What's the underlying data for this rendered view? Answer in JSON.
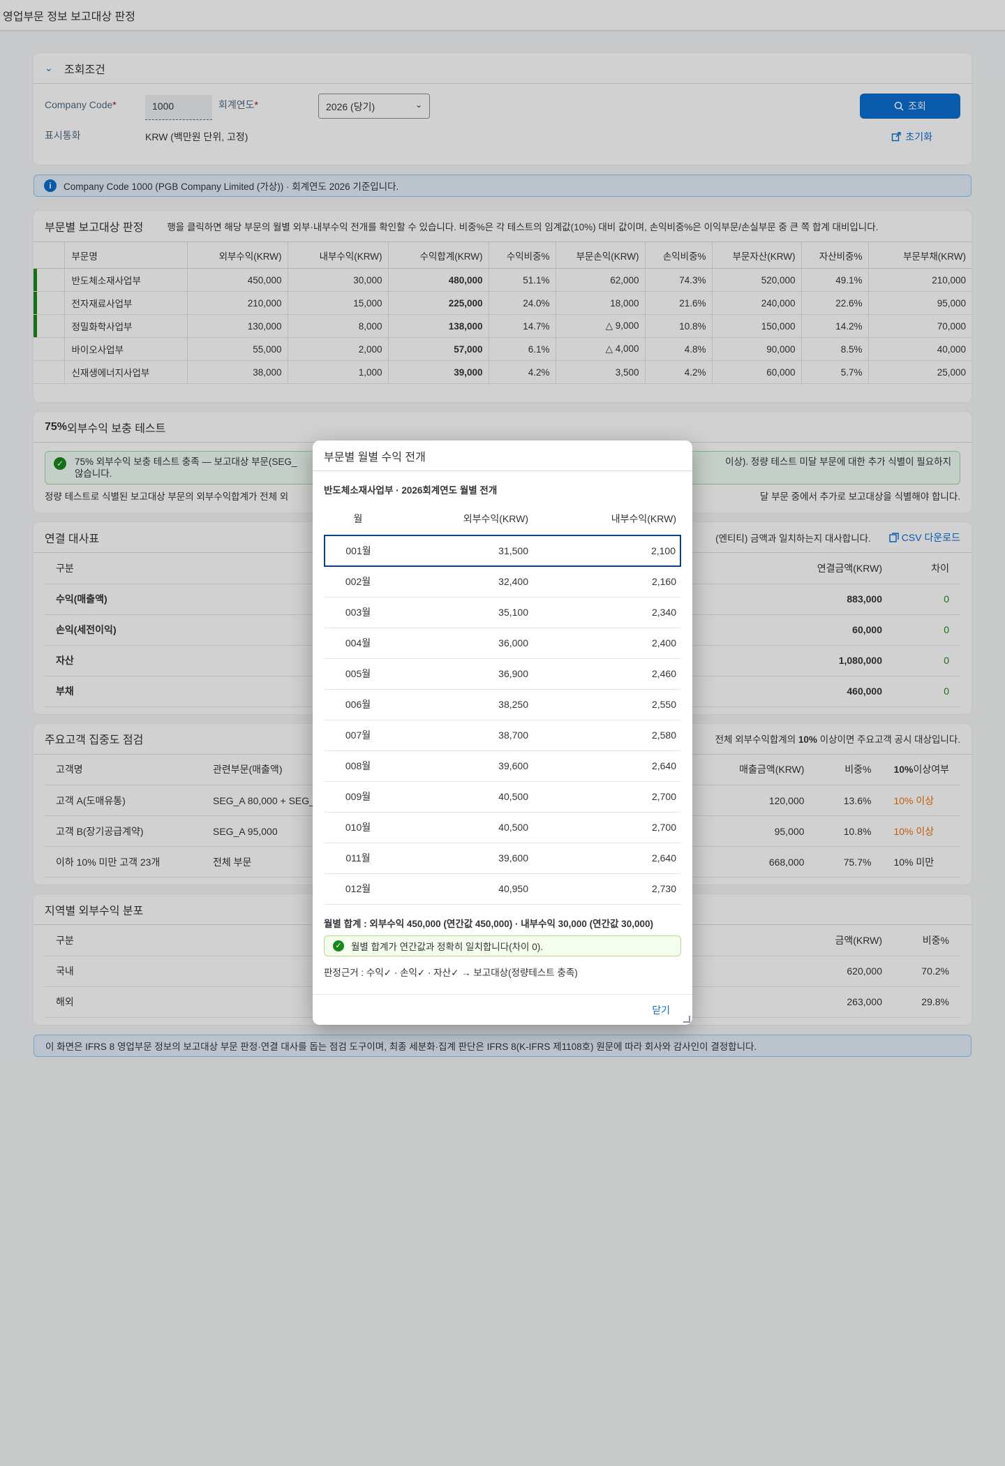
{
  "app_title": "영업부문 정보 보고대상 판정",
  "filter": {
    "title": "조회조건",
    "company_code_label": "Company Code",
    "company_code_value": "1000",
    "fiscal_year_label": "회계연도",
    "fiscal_year_value": "2026 (당기)",
    "currency_label": "표시통화",
    "currency_value": "KRW (백만원 단위, 고정)",
    "search_button": "조회",
    "reset_button": "초기화"
  },
  "info_message": "Company Code 1000 (PGB Company Limited (가상)) · 회계연도 2026 기준입니다.",
  "segment_section": {
    "title": "부문별 보고대상 판정",
    "description": "행을 클릭하면 해당 부문의 월별 외부·내부수익 전개를 확인할 수 있습니다. 비중%은 각 테스트의 임계값(10%) 대비 값이며, 손익비중%은 이익부문/손실부문 중 큰 쪽 합계 대비입니다.",
    "columns": [
      "부문명",
      "외부수익(KRW)",
      "내부수익(KRW)",
      "수익합계(KRW)",
      "수익비중%",
      "부문손익(KRW)",
      "손익비중%",
      "부문자산(KRW)",
      "자산비중%",
      "부문부채(KRW)"
    ],
    "rows": [
      {
        "reportable": true,
        "name": "반도체소재사업부",
        "ext": "450,000",
        "int": "30,000",
        "total": "480,000",
        "rev_pct": "51.1%",
        "pl": "62,000",
        "pl_pct": "74.3%",
        "asset": "520,000",
        "asset_pct": "49.1%",
        "liab": "210,000"
      },
      {
        "reportable": true,
        "name": "전자재료사업부",
        "ext": "210,000",
        "int": "15,000",
        "total": "225,000",
        "rev_pct": "24.0%",
        "pl": "18,000",
        "pl_pct": "21.6%",
        "asset": "240,000",
        "asset_pct": "22.6%",
        "liab": "95,000"
      },
      {
        "reportable": true,
        "name": "정밀화학사업부",
        "ext": "130,000",
        "int": "8,000",
        "total": "138,000",
        "rev_pct": "14.7%",
        "pl": "△ 9,000",
        "pl_pct": "10.8%",
        "asset": "150,000",
        "asset_pct": "14.2%",
        "liab": "70,000"
      },
      {
        "reportable": false,
        "name": "바이오사업부",
        "ext": "55,000",
        "int": "2,000",
        "total": "57,000",
        "rev_pct": "6.1%",
        "pl": "△ 4,000",
        "pl_pct": "4.8%",
        "asset": "90,000",
        "asset_pct": "8.5%",
        "liab": "40,000"
      },
      {
        "reportable": false,
        "name": "신재생에너지사업부",
        "ext": "38,000",
        "int": "1,000",
        "total": "39,000",
        "rev_pct": "4.2%",
        "pl": "3,500",
        "pl_pct": "4.2%",
        "asset": "60,000",
        "asset_pct": "5.7%",
        "liab": "25,000"
      }
    ]
  },
  "coverage_section": {
    "title_bold": "75%",
    "title_rest": " 외부수익 보충 테스트",
    "success_left": "75% 외부수익 보충 테스트 충족 — 보고대상 부문(SEG_",
    "success_right": "이상). 정량 테스트 미달 부문에 대한 추가 식별이 필요하지",
    "success_line2": "않습니다.",
    "note_left": "정량 테스트로 식별된 보고대상 부문의 외부수익합계가 전체 외",
    "note_right": "달 부문 중에서 추가로 보고대상을 식별해야 합니다."
  },
  "recon_section": {
    "title": "연결 대사표",
    "desc_right": "(엔티티) 금액과 일치하는지 대사합니다.",
    "csv_label": "CSV 다운로드",
    "columns": [
      "구분",
      "연결금액(KRW)",
      "차이"
    ],
    "rows": [
      {
        "label": "수익(매출액)",
        "amount": "883,000",
        "diff": "0"
      },
      {
        "label": "손익(세전이익)",
        "amount": "60,000",
        "diff": "0"
      },
      {
        "label": "자산",
        "amount": "1,080,000",
        "diff": "0"
      },
      {
        "label": "부채",
        "amount": "460,000",
        "diff": "0"
      }
    ]
  },
  "customer_section": {
    "title": "주요고객 집중도 점검",
    "desc_pre": "전체 외부수익합계의 ",
    "desc_bold": "10%",
    "desc_post": " 이상이면 주요고객 공시 대상입니다.",
    "columns": [
      "고객명",
      "관련부문(매출액)",
      "매출금액(KRW)",
      "비중%",
      "10%",
      "이상여부"
    ],
    "rows": [
      {
        "name": "고객 A(도매유통)",
        "seg": "SEG_A 80,000 + SEG_B",
        "amount": "120,000",
        "pct": "13.6%",
        "flag": "10% 이상",
        "warn": true
      },
      {
        "name": "고객 B(장기공급계약)",
        "seg": "SEG_A 95,000",
        "amount": "95,000",
        "pct": "10.8%",
        "flag": "10% 이상",
        "warn": true
      },
      {
        "name": "이하 10% 미만 고객 23개",
        "seg": "전체 부문",
        "amount": "668,000",
        "pct": "75.7%",
        "flag": "10% 미만",
        "warn": false
      }
    ]
  },
  "region_section": {
    "title": "지역별 외부수익 분포",
    "columns": [
      "구분",
      "금액(KRW)",
      "비중%"
    ],
    "rows": [
      {
        "label": "국내",
        "amount": "620,000",
        "pct": "70.2%"
      },
      {
        "label": "해외",
        "amount": "263,000",
        "pct": "29.8%"
      }
    ]
  },
  "footer_message": "이 화면은 IFRS 8 영업부문 정보의 보고대상 부문 판정·연결 대사를 돕는 점검 도구이며, 최종 세분화·집계 판단은 IFRS 8(K-IFRS 제1108호) 원문에 따라 회사와 감사인이 결정합니다.",
  "dialog": {
    "title": "부문별 월별 수익 전개",
    "subtitle": "반도체소재사업부 · 2026회계연도 월별 전개",
    "columns": [
      "월",
      "외부수익(KRW)",
      "내부수익(KRW)"
    ],
    "rows": [
      {
        "month": "001월",
        "ext": "31,500",
        "int": "2,100"
      },
      {
        "month": "002월",
        "ext": "32,400",
        "int": "2,160"
      },
      {
        "month": "003월",
        "ext": "35,100",
        "int": "2,340"
      },
      {
        "month": "004월",
        "ext": "36,000",
        "int": "2,400"
      },
      {
        "month": "005월",
        "ext": "36,900",
        "int": "2,460"
      },
      {
        "month": "006월",
        "ext": "38,250",
        "int": "2,550"
      },
      {
        "month": "007월",
        "ext": "38,700",
        "int": "2,580"
      },
      {
        "month": "008월",
        "ext": "39,600",
        "int": "2,640"
      },
      {
        "month": "009월",
        "ext": "40,500",
        "int": "2,700"
      },
      {
        "month": "010월",
        "ext": "40,500",
        "int": "2,700"
      },
      {
        "month": "011월",
        "ext": "39,600",
        "int": "2,640"
      },
      {
        "month": "012월",
        "ext": "40,950",
        "int": "2,730"
      }
    ],
    "sum_line": "월별 합계 : 외부수익 450,000 (연간값 450,000) · 내부수익 30,000 (연간값 30,000)",
    "match_message": "월별 합계가 연간값과 정확히 일치합니다(차이 0).",
    "basis": "판정근거 : 수익✓ · 손익✓ · 자산✓ → 보고대상(정량테스트 충족)",
    "close_button": "닫기"
  },
  "colors": {
    "accent": "#0a6ed1",
    "success": "#188918",
    "warning": "#e9730c",
    "error": "#bb0000"
  }
}
